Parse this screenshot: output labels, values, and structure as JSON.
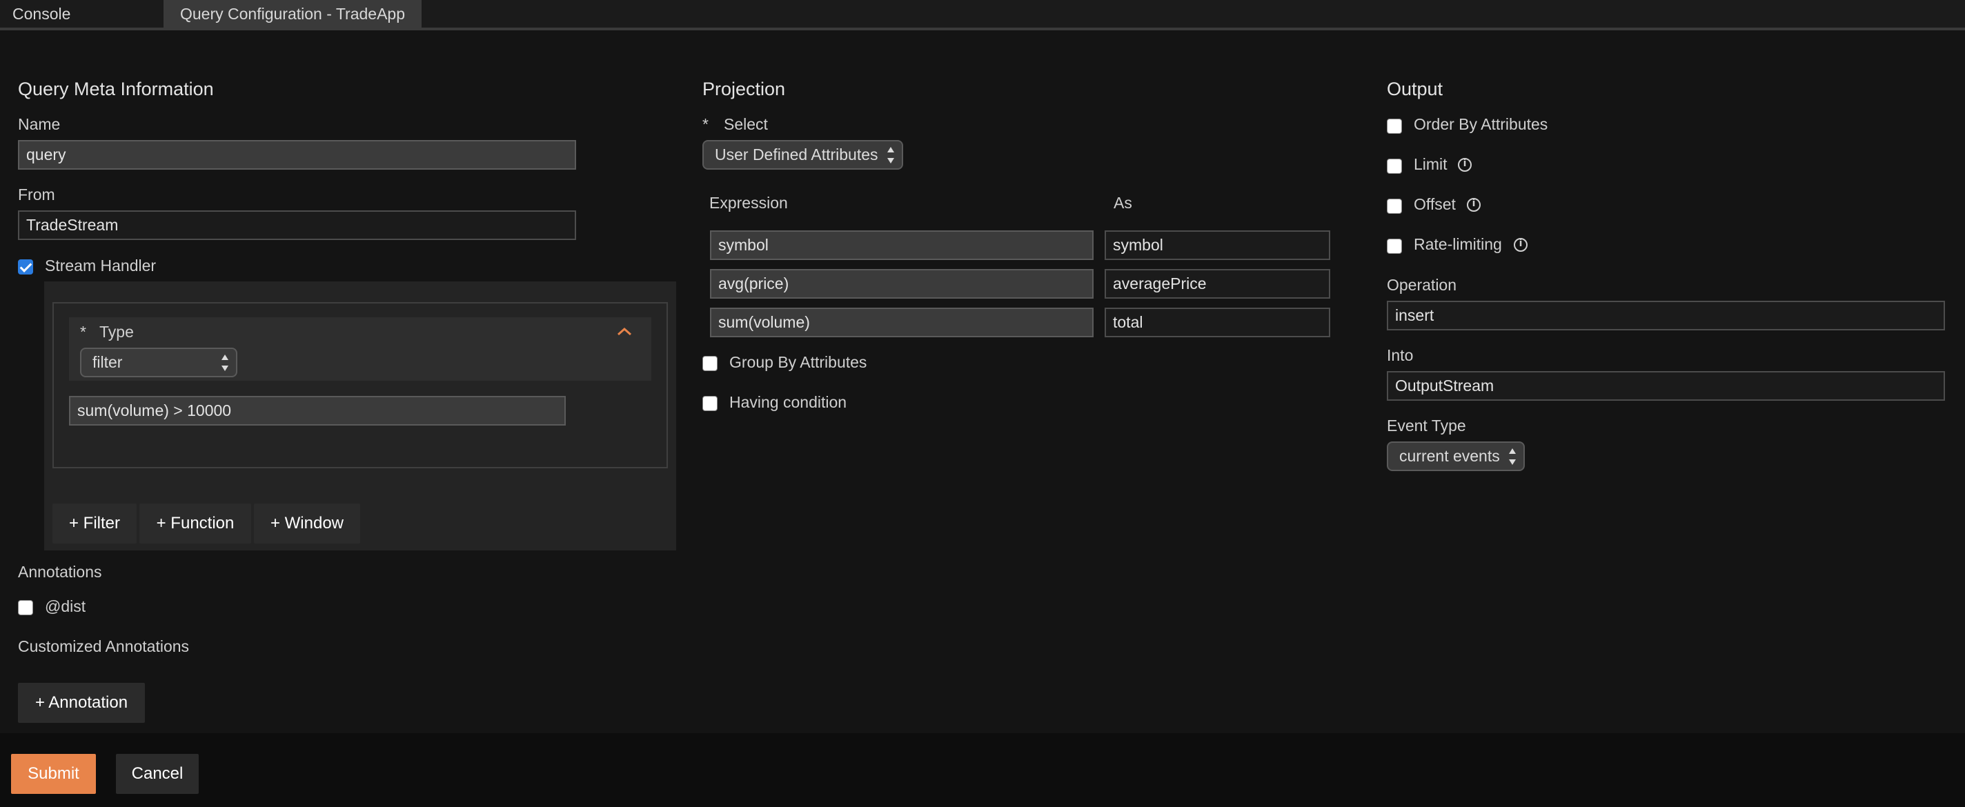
{
  "tabs": [
    {
      "label": "Console"
    },
    {
      "label": "Query Configuration - TradeApp"
    }
  ],
  "meta": {
    "heading": "Query Meta Information",
    "name_label": "Name",
    "name_value": "query",
    "from_label": "From",
    "from_value": "TradeStream",
    "stream_handler_label": "Stream Handler",
    "stream_handler_checked": true,
    "handler": {
      "required_mark": "*",
      "type_label": "Type",
      "type_value": "filter",
      "expression": "sum(volume) > 10000",
      "buttons": [
        "+ Filter",
        "+ Function",
        "+ Window"
      ]
    },
    "annotations_label": "Annotations",
    "dist_label": "@dist",
    "customized_label": "Customized Annotations",
    "add_annotation": "+ Annotation"
  },
  "projection": {
    "heading": "Projection",
    "required_mark": "*",
    "select_label": "Select",
    "select_value": "User Defined Attributes",
    "expression_header": "Expression",
    "as_header": "As",
    "rows": [
      {
        "expression": "symbol",
        "as": "symbol"
      },
      {
        "expression": "avg(price)",
        "as": "averagePrice"
      },
      {
        "expression": "sum(volume)",
        "as": "total"
      }
    ],
    "group_by_label": "Group By Attributes",
    "having_label": "Having condition"
  },
  "output": {
    "heading": "Output",
    "order_by_label": "Order By Attributes",
    "limit_label": "Limit",
    "offset_label": "Offset",
    "rate_limiting_label": "Rate-limiting",
    "operation_label": "Operation",
    "operation_value": "insert",
    "into_label": "Into",
    "into_value": "OutputStream",
    "event_type_label": "Event Type",
    "event_type_value": "current events"
  },
  "footer": {
    "submit": "Submit",
    "cancel": "Cancel"
  },
  "colors": {
    "accent": "#e8844a",
    "checkbox_checked": "#2a7ce0",
    "background": "#141414"
  }
}
